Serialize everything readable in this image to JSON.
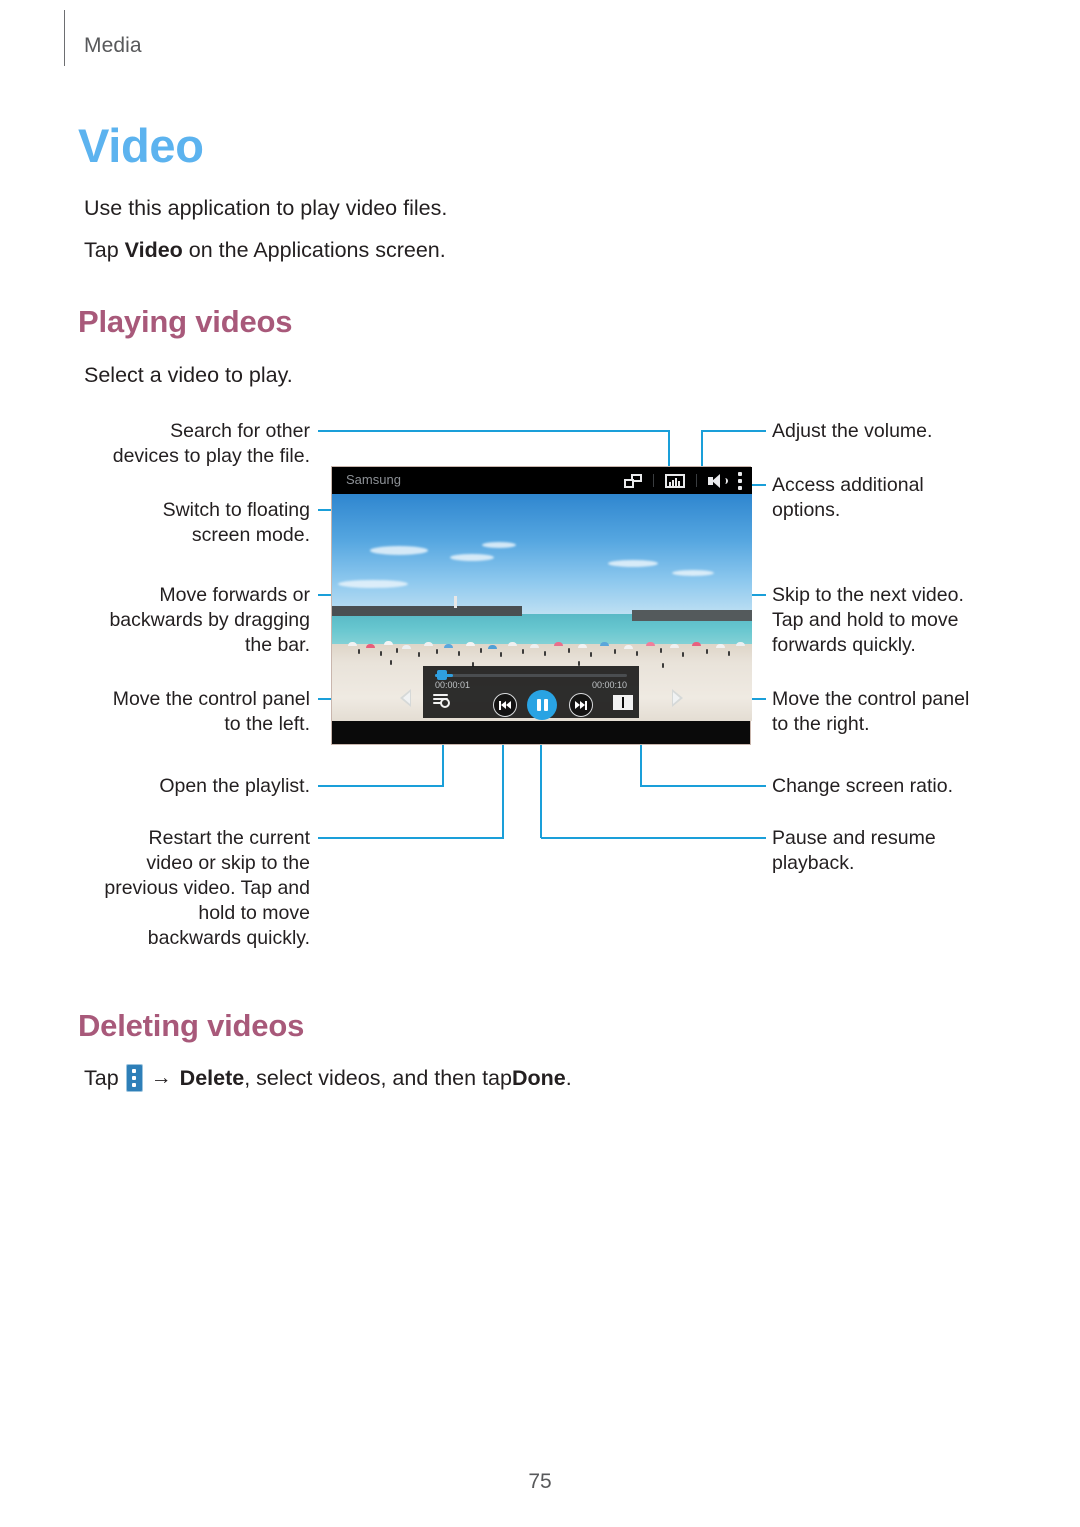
{
  "page": {
    "running_head": "Media",
    "folio": "75"
  },
  "sections": {
    "video": {
      "title": "Video",
      "line1": "Use this application to play video files.",
      "line2_pre": "Tap ",
      "line2_bold": "Video",
      "line2_post": " on the Applications screen."
    },
    "playing_videos": {
      "title": "Playing videos",
      "body": "Select a video to play."
    },
    "deleting_videos": {
      "title": "Deleting videos",
      "tap_word": "Tap",
      "menu_icon": "overflow-menu-icon",
      "arrow": "→",
      "delete_word": "Delete",
      "middle": ", select videos, and then tap ",
      "done_word": "Done",
      "period": "."
    }
  },
  "callouts": {
    "left": [
      {
        "id": "search-devices",
        "lines": [
          "Search for other",
          "devices to play the file."
        ]
      },
      {
        "id": "floating-screen",
        "lines": [
          "Switch to floating",
          "screen mode."
        ]
      },
      {
        "id": "seek-bar",
        "lines": [
          "Move forwards or",
          "backwards by dragging",
          "the bar."
        ]
      },
      {
        "id": "panel-left",
        "lines": [
          "Move the control panel",
          "to the left."
        ]
      },
      {
        "id": "playlist",
        "lines": [
          "Open the playlist."
        ]
      },
      {
        "id": "previous",
        "lines": [
          "Restart the current",
          "video or skip to the",
          "previous video. Tap and",
          "hold to move",
          "backwards quickly."
        ]
      }
    ],
    "right": [
      {
        "id": "volume",
        "lines": [
          "Adjust the volume."
        ]
      },
      {
        "id": "more-options",
        "lines": [
          "Access additional",
          "options."
        ]
      },
      {
        "id": "next",
        "lines": [
          "Skip to the next video.",
          "Tap and hold to move",
          "forwards quickly."
        ]
      },
      {
        "id": "panel-right",
        "lines": [
          "Move the control panel",
          "to the right."
        ]
      },
      {
        "id": "screen-ratio",
        "lines": [
          "Change screen ratio."
        ]
      },
      {
        "id": "pause-resume",
        "lines": [
          "Pause and resume",
          "playback."
        ]
      }
    ]
  },
  "device": {
    "status_title": "Samsung",
    "status_icons": [
      "popup-play-icon",
      "screen-mirroring-icon",
      "volume-icon",
      "overflow-menu-icon"
    ],
    "player": {
      "elapsed": "00:00:01",
      "duration": "00:00:10",
      "buttons": [
        "playlist-icon",
        "previous-icon",
        "pause-icon",
        "next-icon",
        "screen-ratio-icon"
      ],
      "move_left_icon": "move-panel-left-icon",
      "move_right_icon": "move-panel-right-icon"
    }
  },
  "colors": {
    "accent_blue": "#5cb3ef",
    "heading_rose": "#a8597a",
    "leader_line": "#1a9fd9",
    "player_accent": "#29a3e3",
    "body_text": "#231f20"
  }
}
